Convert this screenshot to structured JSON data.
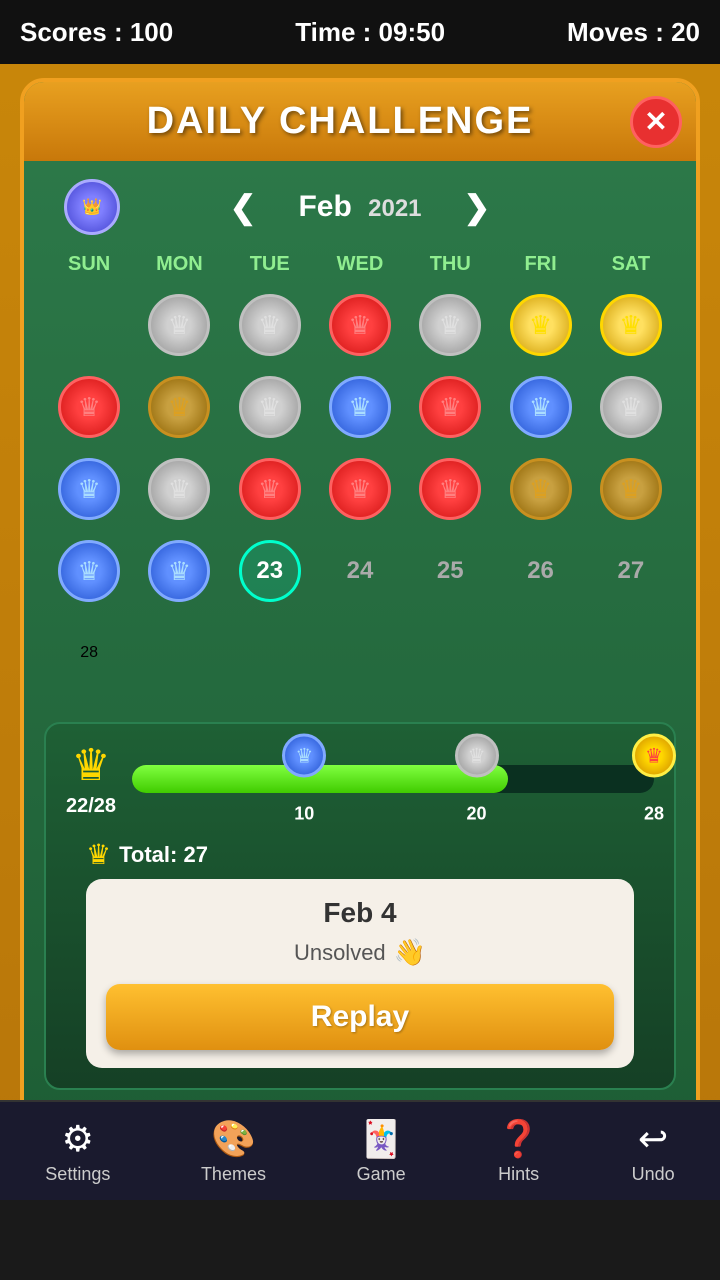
{
  "statusBar": {
    "scores_label": "Scores : 100",
    "time_label": "Time : 09:50",
    "moves_label": "Moves : 20"
  },
  "dialog": {
    "title": "DAILY CHALLENGE",
    "close_icon": "✕",
    "month": "Feb",
    "year": "2021",
    "prev_arrow": "❮",
    "next_arrow": "❯"
  },
  "calendar": {
    "headers": [
      "SUN",
      "MON",
      "TUE",
      "WED",
      "THU",
      "FRI",
      "SAT"
    ],
    "rows": [
      [
        {
          "type": "empty"
        },
        {
          "type": "badge",
          "style": "silver",
          "crown": "silver"
        },
        {
          "type": "badge",
          "style": "silver",
          "crown": "silver"
        },
        {
          "type": "badge",
          "style": "red-ring",
          "crown": "red"
        },
        {
          "type": "badge",
          "style": "silver",
          "crown": "silver"
        },
        {
          "type": "badge",
          "style": "gold",
          "crown": "gold"
        },
        {
          "type": "badge",
          "style": "gold",
          "crown": "gold"
        }
      ],
      [
        {
          "type": "badge",
          "style": "red-ring",
          "crown": "red"
        },
        {
          "type": "badge",
          "style": "gold-dark",
          "crown": "gold-dark"
        },
        {
          "type": "badge",
          "style": "silver",
          "crown": "silver"
        },
        {
          "type": "badge",
          "style": "blue",
          "crown": "blue"
        },
        {
          "type": "badge",
          "style": "red-ring",
          "crown": "red"
        },
        {
          "type": "badge",
          "style": "blue",
          "crown": "blue"
        },
        {
          "type": "badge",
          "style": "silver",
          "crown": "silver"
        }
      ],
      [
        {
          "type": "badge",
          "style": "blue",
          "crown": "blue"
        },
        {
          "type": "badge",
          "style": "silver",
          "crown": "silver"
        },
        {
          "type": "badge",
          "style": "red-ring",
          "crown": "red"
        },
        {
          "type": "badge",
          "style": "red-ring",
          "crown": "red"
        },
        {
          "type": "badge",
          "style": "red-ring",
          "crown": "red"
        },
        {
          "type": "badge",
          "style": "gold-dark",
          "crown": "gold-dark"
        },
        {
          "type": "badge",
          "style": "gold-dark",
          "crown": "gold-dark"
        }
      ],
      [
        {
          "type": "badge",
          "style": "blue",
          "crown": "blue"
        },
        {
          "type": "badge",
          "style": "blue",
          "crown": "blue"
        },
        {
          "type": "today",
          "num": "23"
        },
        {
          "type": "num",
          "num": "24"
        },
        {
          "type": "num",
          "num": "25"
        },
        {
          "type": "num",
          "num": "26"
        },
        {
          "type": "num",
          "num": "27"
        }
      ],
      [
        {
          "type": "num28",
          "num": "28"
        },
        {
          "type": "empty"
        },
        {
          "type": "empty"
        },
        {
          "type": "empty"
        },
        {
          "type": "empty"
        },
        {
          "type": "empty"
        },
        {
          "type": "empty"
        }
      ]
    ]
  },
  "progress": {
    "crown_icon": "♛",
    "count": "22/28",
    "milestones": [
      {
        "value": 10,
        "pct": "33%",
        "style": "blue"
      },
      {
        "value": 20,
        "pct": "66%",
        "style": "silver"
      },
      {
        "value": 28,
        "pct": "100%",
        "style": "sun"
      }
    ],
    "total_label": "Total: 27",
    "crown_total": "♛"
  },
  "detail": {
    "date": "Feb 4",
    "status": "Unsolved",
    "hand_icon": "👋",
    "replay_label": "Replay"
  },
  "bottomNav": {
    "items": [
      {
        "icon": "⚙",
        "label": "Settings"
      },
      {
        "icon": "🎨",
        "label": "Themes"
      },
      {
        "icon": "🃏",
        "label": "Game"
      },
      {
        "icon": "?",
        "label": "Hints"
      },
      {
        "icon": "↩",
        "label": "Undo"
      }
    ]
  }
}
